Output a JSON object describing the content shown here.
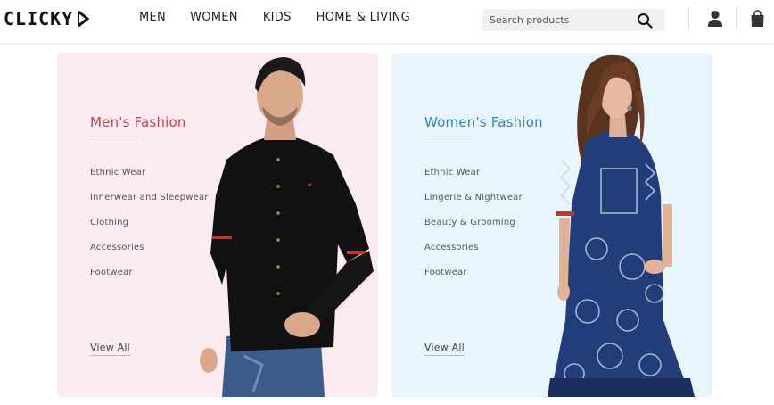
{
  "brand": {
    "name": "CLICKY"
  },
  "nav": [
    {
      "label": "MEN"
    },
    {
      "label": "WOMEN"
    },
    {
      "label": "KIDS"
    },
    {
      "label": "HOME & LIVING"
    }
  ],
  "search": {
    "placeholder": "Search products",
    "value": "",
    "icon": "search-icon"
  },
  "header_icons": {
    "user": "user-icon",
    "bag": "shopping-bag-icon"
  },
  "colors": {
    "men_accent": "#d23a48",
    "women_accent": "#2c86c8",
    "men_card_bg": "#fcebf1",
    "women_card_bg": "#e9f5fd"
  },
  "cards": {
    "men": {
      "title": "Men's Fashion",
      "items": [
        "Ethnic Wear",
        "Innerwear and Sleepwear",
        "Clothing",
        "Accessories",
        "Footwear"
      ],
      "view_all": "View All"
    },
    "women": {
      "title": "Women's Fashion",
      "items": [
        "Ethnic Wear",
        "Lingerie & Nightwear",
        "Beauty & Grooming",
        "Accessories",
        "Footwear"
      ],
      "view_all": "View All"
    }
  }
}
